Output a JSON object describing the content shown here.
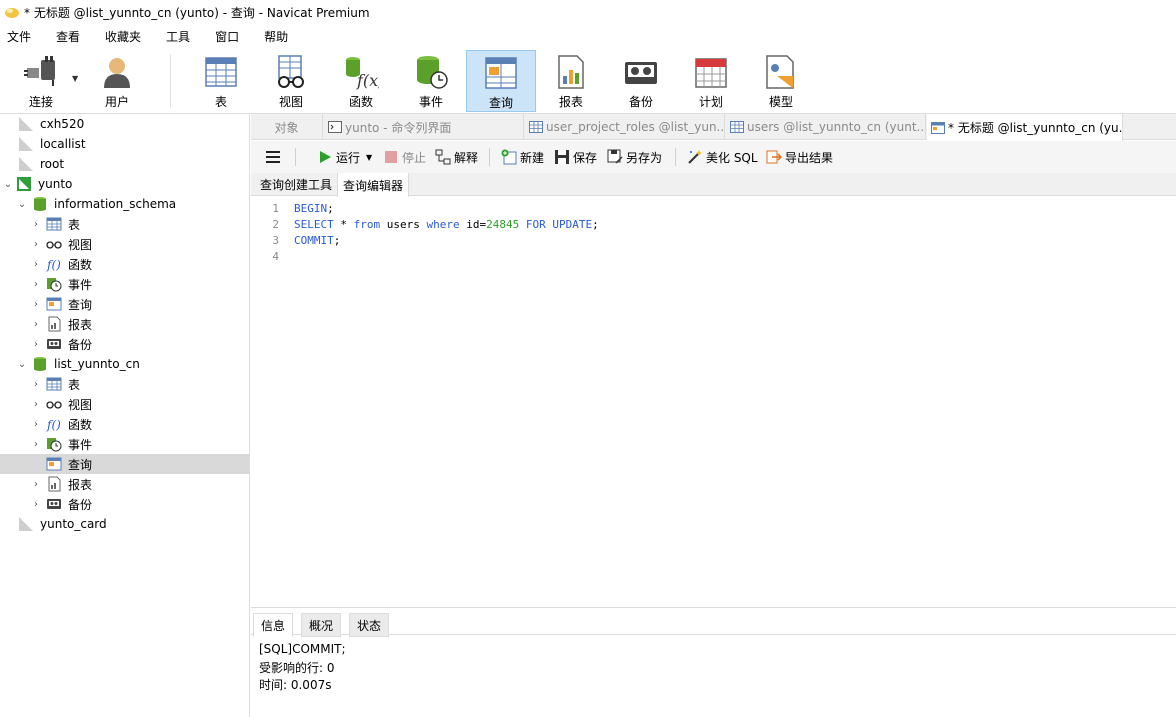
{
  "window": {
    "title": "* 无标题 @list_yunnto_cn (yunto) - 查询 - Navicat Premium"
  },
  "menubar": {
    "items": [
      "文件",
      "查看",
      "收藏夹",
      "工具",
      "窗口",
      "帮助"
    ]
  },
  "toolbar": {
    "connect": "连接",
    "user": "用户",
    "table": "表",
    "view": "视图",
    "function": "函数",
    "event": "事件",
    "query": "查询",
    "report": "报表",
    "backup": "备份",
    "schedule": "计划",
    "model": "模型"
  },
  "sidebar": {
    "connections": [
      "cxh520",
      "locallist",
      "root",
      "yunto",
      "yunto_card"
    ],
    "db1": {
      "name": "information_schema",
      "items": [
        "表",
        "视图",
        "函数",
        "事件",
        "查询",
        "报表",
        "备份"
      ]
    },
    "db2": {
      "name": "list_yunnto_cn",
      "items": [
        "表",
        "视图",
        "函数",
        "事件",
        "查询",
        "报表",
        "备份"
      ]
    }
  },
  "tabs": {
    "objects": "对象",
    "t1": "yunto - 命令列界面",
    "t2": "user_project_roles @list_yun...",
    "t3": "users @list_yunnto_cn (yunt...",
    "t4": "* 无标题 @list_yunnto_cn (yu..."
  },
  "query_toolbar": {
    "run": "运行",
    "stop": "停止",
    "explain": "解释",
    "new": "新建",
    "save": "保存",
    "save_as": "另存为",
    "beautify": "美化 SQL",
    "export": "导出结果"
  },
  "subtabs": {
    "builder": "查询创建工具",
    "editor": "查询编辑器"
  },
  "editor": {
    "line_numbers": [
      "1",
      "2",
      "3",
      "4"
    ],
    "l1_kw": "BEGIN",
    "l1_rest": ";",
    "l2_kw1": "SELECT",
    "l2_t1": " * ",
    "l2_kw2": "from",
    "l2_t2": " users ",
    "l2_kw3": "where",
    "l2_t3": " id=",
    "l2_num": "24845",
    "l2_t4": " ",
    "l2_kw4": "FOR UPDATE",
    "l2_t5": ";",
    "l3_kw": "COMMIT",
    "l3_rest": ";"
  },
  "result": {
    "tabs": [
      "信息",
      "概况",
      "状态"
    ],
    "lines": [
      "[SQL]COMMIT;",
      "受影响的行: 0",
      "时间: 0.007s"
    ]
  }
}
